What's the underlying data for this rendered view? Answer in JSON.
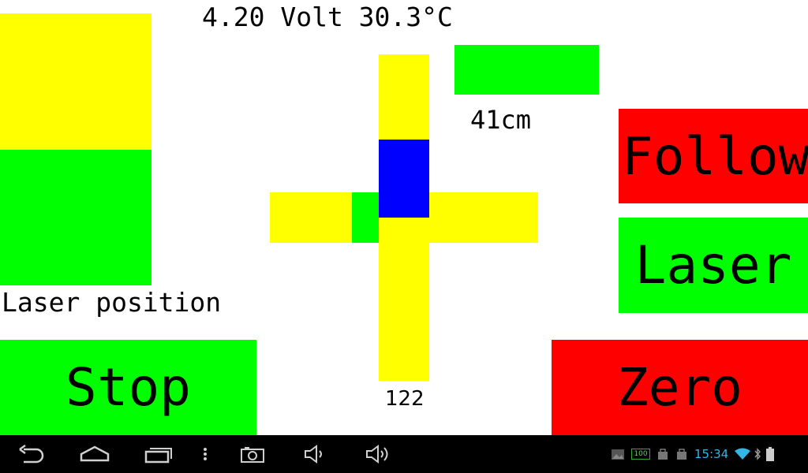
{
  "header": {
    "status": "4.20 Volt 30.3°C"
  },
  "laser_position": {
    "label": "Laser position",
    "level": 0.5
  },
  "distance": {
    "label": "41cm"
  },
  "crosshair": {
    "value": "122"
  },
  "buttons": {
    "follow": "Follow",
    "laser": "Laser",
    "stop": "Stop",
    "zero": "Zero"
  },
  "system_bar": {
    "time": "15:34",
    "battery": "100",
    "icons": [
      "back-icon",
      "home-icon",
      "recent-apps-icon",
      "menu-icon",
      "camera-icon",
      "volume-down-icon",
      "volume-up-icon",
      "gallery-icon",
      "battery-icon",
      "bag-icon",
      "bag-icon",
      "wifi-icon",
      "bluetooth-icon",
      "battery-icon"
    ]
  },
  "colors": {
    "yellow": "#ffff00",
    "green": "#00ff00",
    "red": "#ff0000",
    "blue": "#0000ff",
    "clock": "#33b5e5"
  }
}
